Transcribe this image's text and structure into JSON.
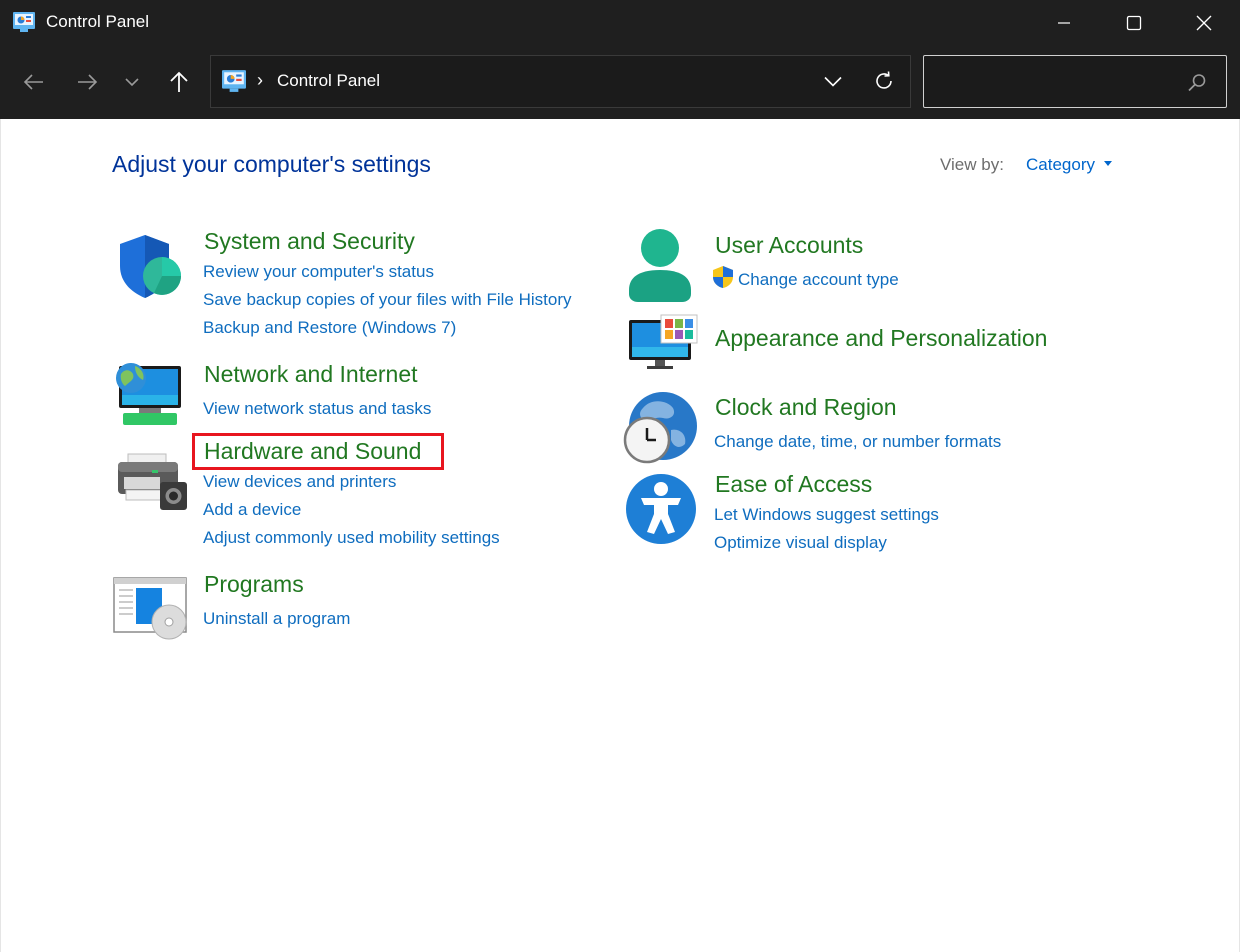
{
  "window": {
    "title": "Control Panel"
  },
  "navigation": {
    "breadcrumb_separator": "›",
    "breadcrumb": "Control Panel",
    "search_placeholder": ""
  },
  "main": {
    "heading": "Adjust your computer's settings",
    "view_by_label": "View by:",
    "view_by_value": "Category"
  },
  "categories": {
    "system_security": {
      "title": "System and Security",
      "links": [
        "Review your computer's status",
        "Save backup copies of your files with File History",
        "Backup and Restore (Windows 7)"
      ]
    },
    "network_internet": {
      "title": "Network and Internet",
      "links": [
        "View network status and tasks"
      ]
    },
    "hardware_sound": {
      "title": "Hardware and Sound",
      "links": [
        "View devices and printers",
        "Add a device",
        "Adjust commonly used mobility settings"
      ]
    },
    "programs": {
      "title": "Programs",
      "links": [
        "Uninstall a program"
      ]
    },
    "user_accounts": {
      "title": "User Accounts",
      "links": [
        "Change account type"
      ]
    },
    "appearance": {
      "title": "Appearance and Personalization",
      "links": []
    },
    "clock_region": {
      "title": "Clock and Region",
      "links": [
        "Change date, time, or number formats"
      ]
    },
    "ease_access": {
      "title": "Ease of Access",
      "links": [
        "Let Windows suggest settings",
        "Optimize visual display"
      ]
    }
  },
  "colors": {
    "titlebar_bg": "#1f1f1f",
    "heading": "#003399",
    "category_title": "#217821",
    "link": "#0f6dbf",
    "highlight": "#e8151f"
  }
}
